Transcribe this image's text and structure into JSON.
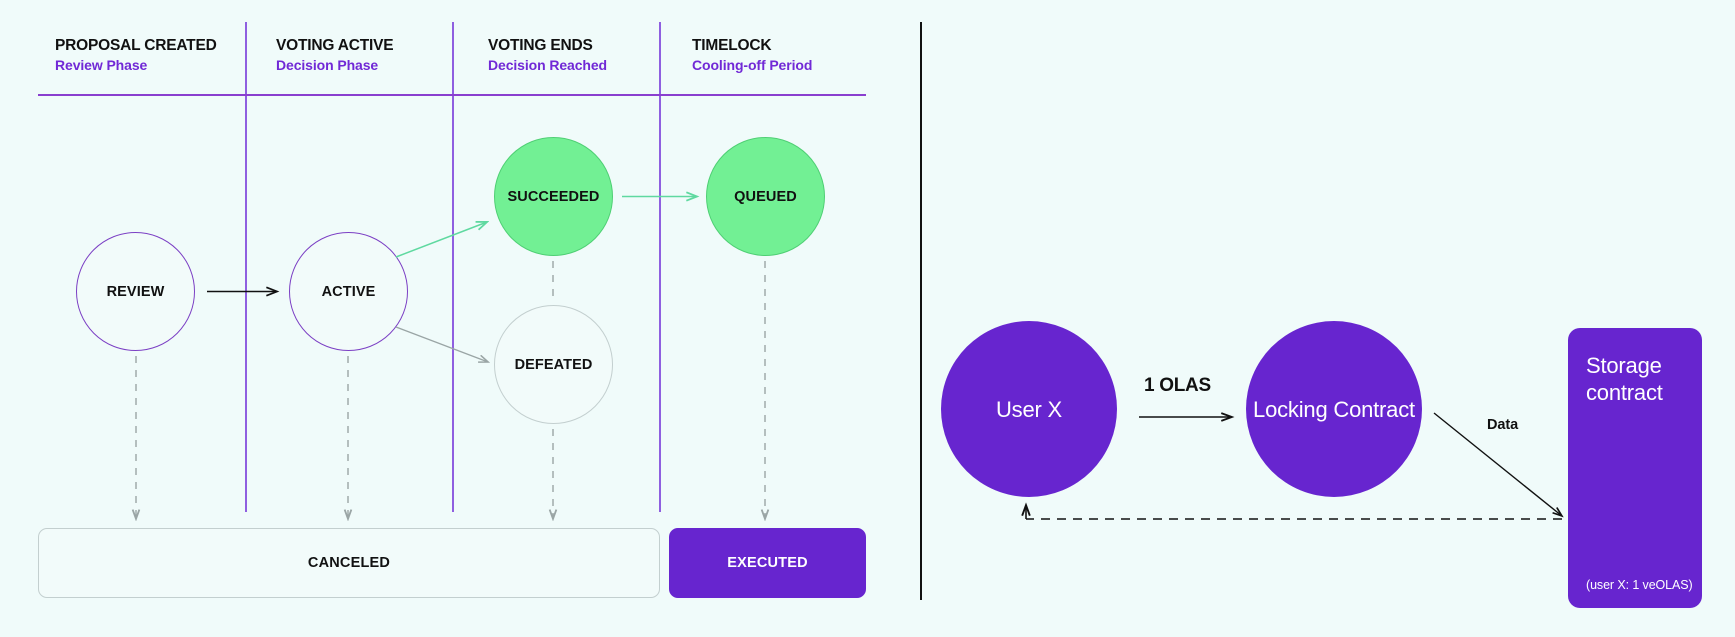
{
  "background_color": "#f0fbfa",
  "colors": {
    "purple": "#6725cf",
    "purple_line": "#8f5fe0",
    "purple_text": "#7129d6",
    "green": "#72f094",
    "green_arrow": "#5fd9a0",
    "gray_line": "#9aa5a5",
    "gray_border": "#c3cfcf",
    "black": "#111111",
    "white": "#ffffff"
  },
  "left_panel": {
    "name": "governance-proposal-lifecycle",
    "phases": [
      {
        "title": "PROPOSAL CREATED",
        "subtitle": "Review Phase"
      },
      {
        "title": "VOTING ACTIVE",
        "subtitle": "Decision Phase"
      },
      {
        "title": "VOTING ENDS",
        "subtitle": "Decision Reached"
      },
      {
        "title": "TIMELOCK",
        "subtitle": "Cooling-off Period"
      }
    ],
    "states": [
      {
        "id": "review",
        "label": "REVIEW",
        "style": "outline-purple"
      },
      {
        "id": "active",
        "label": "ACTIVE",
        "style": "outline-purple"
      },
      {
        "id": "succeeded",
        "label": "SUCCEEDED",
        "style": "filled-green"
      },
      {
        "id": "defeated",
        "label": "DEFEATED",
        "style": "outline-gray"
      },
      {
        "id": "queued",
        "label": "QUEUED",
        "style": "filled-green"
      }
    ],
    "terminals": [
      {
        "id": "canceled",
        "label": "CANCELED",
        "style": "ghost"
      },
      {
        "id": "executed",
        "label": "EXECUTED",
        "style": "solid"
      }
    ]
  },
  "right_panel": {
    "name": "olas-locking-flow",
    "nodes": [
      {
        "id": "user-x",
        "label": "User X",
        "shape": "circle"
      },
      {
        "id": "locking-contract",
        "label": "Locking\nContract",
        "shape": "circle"
      },
      {
        "id": "storage-contract",
        "label": "Storage\ncontract",
        "shape": "rounded-rect",
        "footnote": "(user X: 1 veOLAS)"
      }
    ],
    "edges": [
      {
        "id": "user-to-locking",
        "caption": "1 OLAS",
        "style": "solid-arrow"
      },
      {
        "id": "locking-to-storage",
        "caption": "Data",
        "style": "solid-arrow"
      },
      {
        "id": "storage-to-user",
        "caption": "",
        "style": "dashed-arrow"
      }
    ]
  }
}
